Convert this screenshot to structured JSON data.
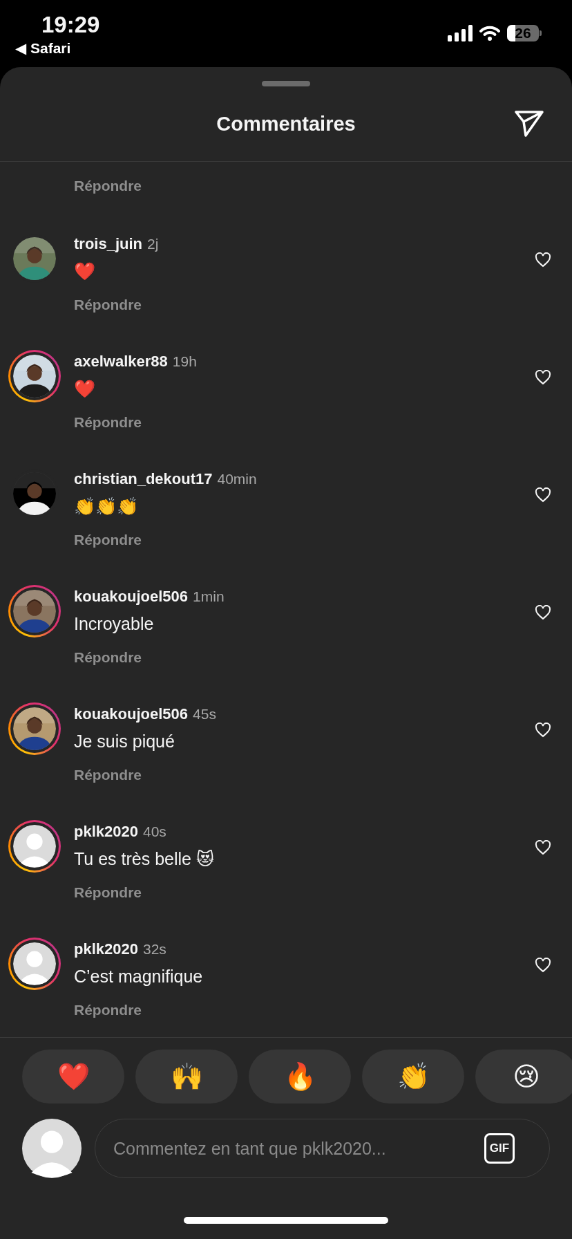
{
  "status_bar": {
    "time": "19:29",
    "back_glyph": "◀",
    "back_label": "Safari",
    "battery": "26"
  },
  "sheet": {
    "title": "Commentaires"
  },
  "partial_comment": {
    "reply": "Répondre"
  },
  "comments": [
    {
      "username": "trois_juin",
      "time": "2j",
      "text": "❤️",
      "reply": "Répondre",
      "ring": false,
      "liked": false
    },
    {
      "username": "axelwalker88",
      "time": "19h",
      "text": "❤️",
      "reply": "Répondre",
      "ring": true,
      "liked": false
    },
    {
      "username": "christian_dekout17",
      "time": "40min",
      "text": "👏👏👏",
      "reply": "Répondre",
      "ring": false,
      "liked": false
    },
    {
      "username": "kouakoujoel506",
      "time": "1min",
      "text": "Incroyable",
      "reply": "Répondre",
      "ring": true,
      "liked": false
    },
    {
      "username": "kouakoujoel506",
      "time": "45s",
      "text": "Je suis piqué",
      "reply": "Répondre",
      "ring": true,
      "liked": false
    },
    {
      "username": "pklk2020",
      "time": "40s",
      "text": "Tu es très belle 😻",
      "reply": "Répondre",
      "avatar": {
        "kind": "default"
      },
      "ring": true,
      "liked": false
    },
    {
      "username": "pklk2020",
      "time": "32s",
      "text": "C’est magnifique",
      "reply": "Répondre",
      "avatar": {
        "kind": "default"
      },
      "ring": true,
      "liked": false
    }
  ],
  "reactions": [
    "❤️",
    "🙌",
    "🔥",
    "👏",
    "😢"
  ],
  "composer": {
    "placeholder": "Commentez en tant que pklk2020...",
    "gif_label": "GIF"
  }
}
